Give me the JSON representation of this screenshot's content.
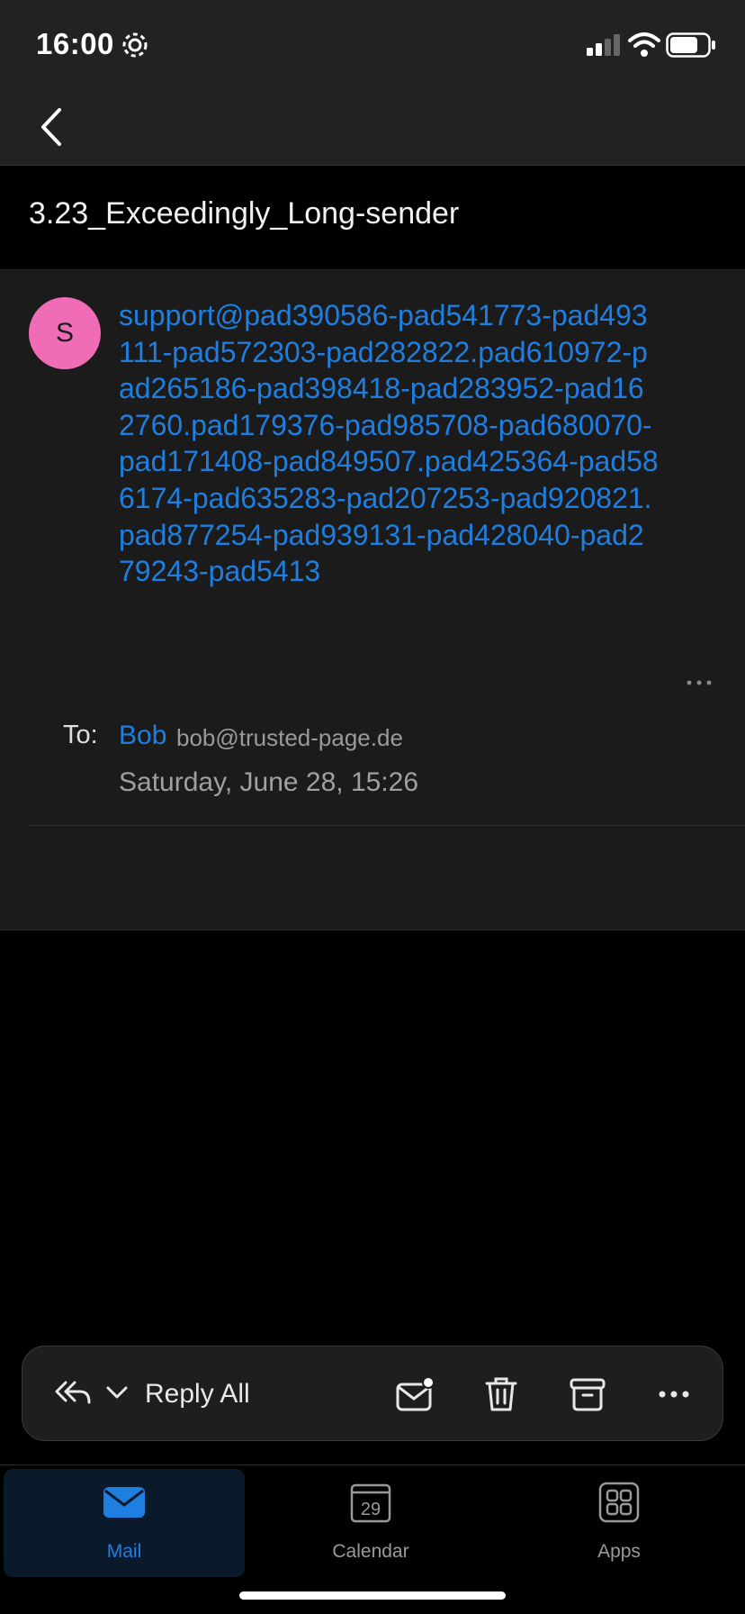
{
  "status": {
    "time": "16:00"
  },
  "email": {
    "subject": "3.23_Exceedingly_Long-sender",
    "avatar_initial": "S",
    "sender": "support@pad390586-pad541773-pad493111-pad572303-pad282822.pad610972-pad265186-pad398418-pad283952-pad162760.pad179376-pad985708-pad680070-pad171408-pad849507.pad425364-pad586174-pad635283-pad207253-pad920821.pad877254-pad939131-pad428040-pad279243-pad5413",
    "to_label": "To:",
    "to_name": "Bob",
    "to_email": "bob@trusted-page.de",
    "date": "Saturday, June 28, 15:26"
  },
  "actions": {
    "reply_label": "Reply All",
    "icons": [
      "reply-all-icon",
      "chevron-down-icon",
      "mark-unread-icon",
      "trash-icon",
      "archive-icon",
      "more-icon"
    ]
  },
  "tabs": [
    {
      "label": "Mail",
      "icon": "mail-icon",
      "active": true
    },
    {
      "label": "Calendar",
      "icon": "calendar-icon",
      "badge": "29",
      "active": false
    },
    {
      "label": "Apps",
      "icon": "apps-icon",
      "active": false
    }
  ],
  "colors": {
    "accent": "#1f7fe0",
    "avatar": "#f06cb6",
    "background": "#000000",
    "surface": "#1b1b1b"
  }
}
